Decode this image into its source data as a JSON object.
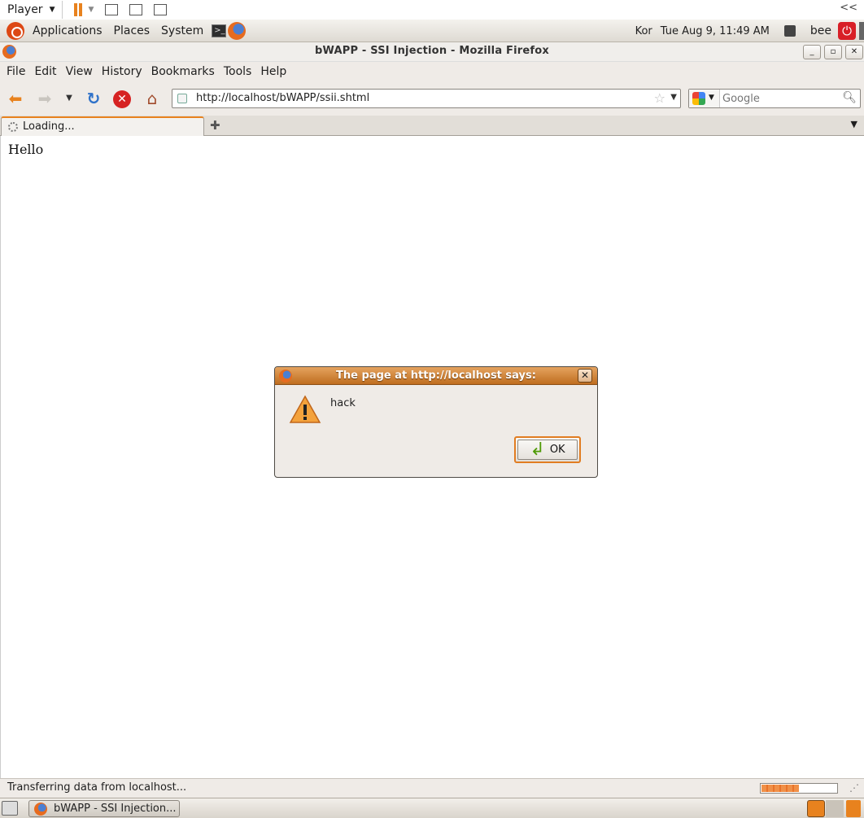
{
  "player_bar": {
    "label": "Player",
    "collapse": "<<"
  },
  "gnome_panel": {
    "menus": [
      "Applications",
      "Places",
      "System"
    ],
    "keyboard": "Kor",
    "clock": "Tue Aug  9, 11:49 AM",
    "user": "bee"
  },
  "window": {
    "title": "bWAPP - SSI Injection - Mozilla Firefox"
  },
  "menubar": {
    "items": [
      "File",
      "Edit",
      "View",
      "History",
      "Bookmarks",
      "Tools",
      "Help"
    ]
  },
  "navbar": {
    "url": "http://localhost/bWAPP/ssii.shtml",
    "search_placeholder": "Google"
  },
  "tabs": [
    {
      "label": "Loading..."
    }
  ],
  "content": {
    "text": "Hello"
  },
  "alert": {
    "title": "The page at http://localhost says:",
    "message": "hack",
    "ok_label": "OK"
  },
  "status": {
    "text": "Transferring data from localhost...",
    "progress": 0.5
  },
  "taskbar": {
    "items": [
      {
        "label": "bWAPP - SSI Injection..."
      }
    ]
  },
  "colors": {
    "accent": "#e8821e",
    "dialog_title": "#bf6d1f",
    "ok_border": "#e17d22"
  }
}
